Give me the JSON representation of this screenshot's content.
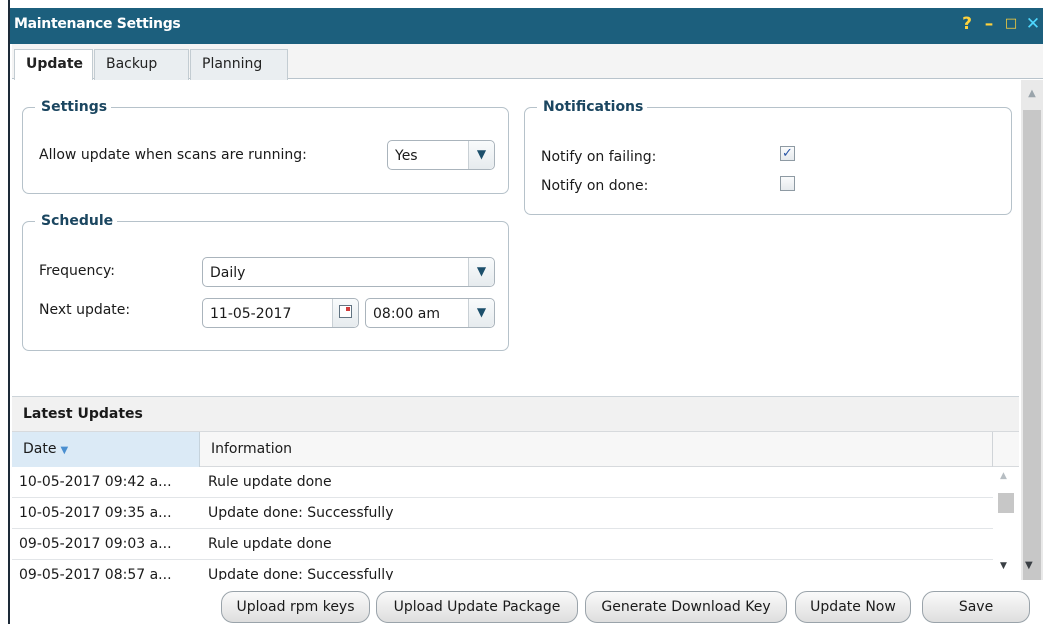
{
  "window": {
    "title": "Maintenance Settings",
    "controls": {
      "help": "?",
      "minimize": "–",
      "maximize": "□",
      "close": "✕"
    }
  },
  "tabs": [
    {
      "label": "Update",
      "active": true
    },
    {
      "label": "Backup",
      "active": false
    },
    {
      "label": "Planning",
      "active": false
    }
  ],
  "settings": {
    "legend": "Settings",
    "allow_update_label": "Allow update when scans are running:",
    "allow_update_value": "Yes"
  },
  "schedule": {
    "legend": "Schedule",
    "frequency_label": "Frequency:",
    "frequency_value": "Daily",
    "next_update_label": "Next update:",
    "next_update_date": "11-05-2017",
    "next_update_time": "08:00 am"
  },
  "notifications": {
    "legend": "Notifications",
    "notify_failing_label": "Notify on failing:",
    "notify_failing_checked": true,
    "notify_done_label": "Notify on done:",
    "notify_done_checked": false
  },
  "latest_updates": {
    "title": "Latest Updates",
    "columns": {
      "date": "Date",
      "information": "Information"
    },
    "rows": [
      {
        "date": "10-05-2017 09:42 a...",
        "info": "Rule update done"
      },
      {
        "date": "10-05-2017 09:35 a...",
        "info": "Update done: Successfully"
      },
      {
        "date": "09-05-2017 09:03 a...",
        "info": "Rule update done"
      },
      {
        "date": "09-05-2017 08:57 a...",
        "info": "Update done: Successfully"
      }
    ]
  },
  "buttons": {
    "upload_rpm": "Upload rpm keys",
    "upload_package": "Upload Update Package",
    "generate_key": "Generate Download Key",
    "update_now": "Update Now",
    "save": "Save"
  },
  "colors": {
    "titlebar": "#1c5f7d",
    "accent_text": "#1b4660"
  }
}
